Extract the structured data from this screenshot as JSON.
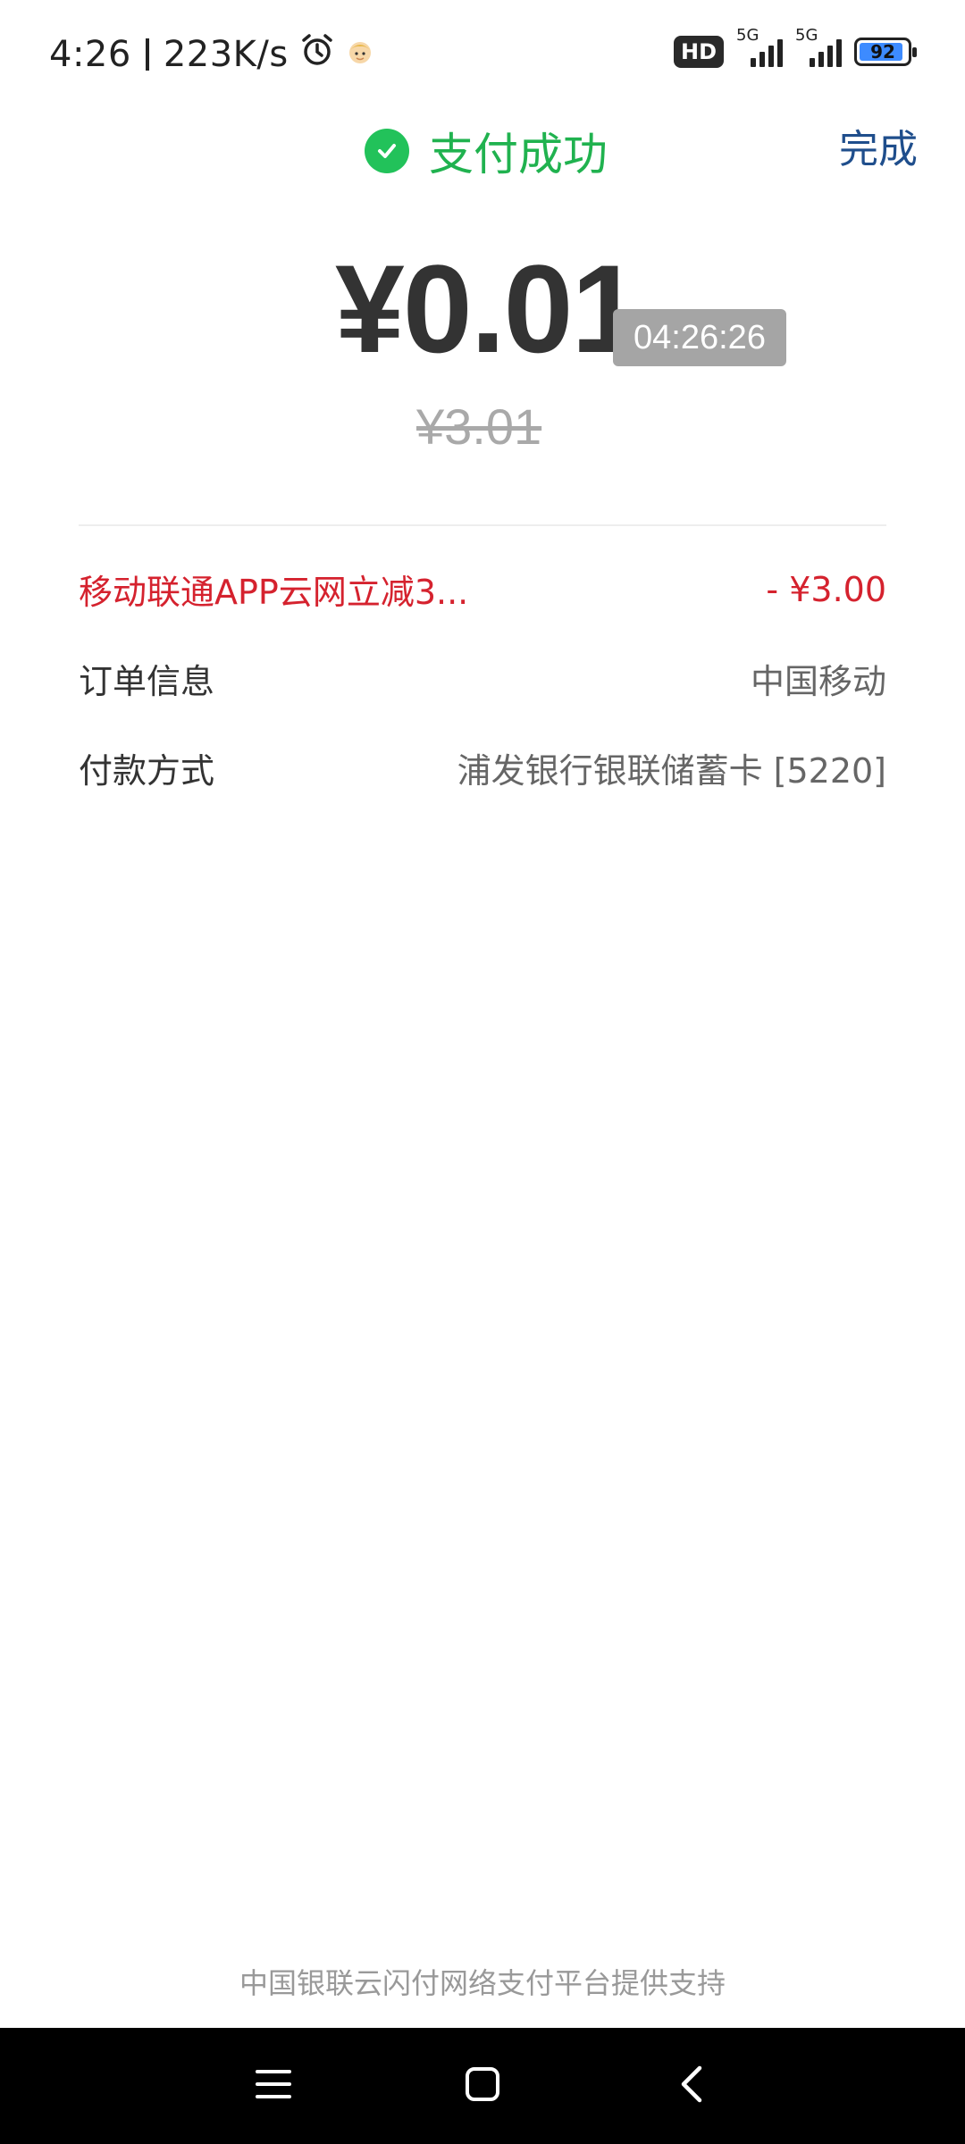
{
  "status_bar": {
    "time": "4:26",
    "net_speed": "223K/s",
    "hd_label": "HD",
    "network1": "5G",
    "network2": "5G",
    "battery": "92",
    "battery_level": 0.92
  },
  "header": {
    "title": "支付成功",
    "done_label": "完成"
  },
  "payment": {
    "amount": "¥0.01",
    "time": "04:26:26",
    "original_amount": "¥3.01"
  },
  "details": [
    {
      "label": "移动联通APP云网立减3...",
      "value": "- ¥3.00"
    },
    {
      "label": "订单信息",
      "value": "中国移动"
    },
    {
      "label": "付款方式",
      "value": "浦发银行银联储蓄卡 [5220]"
    }
  ],
  "footer": {
    "text": "中国银联云闪付网络支付平台提供支持"
  },
  "colors": {
    "success": "#22c25a",
    "link": "#1f4e8c",
    "discount": "#d5222e"
  },
  "icons": [
    "alarm-icon",
    "emoji-avatar-icon",
    "check-circle-icon",
    "menu-icon",
    "home-icon",
    "back-icon"
  ]
}
